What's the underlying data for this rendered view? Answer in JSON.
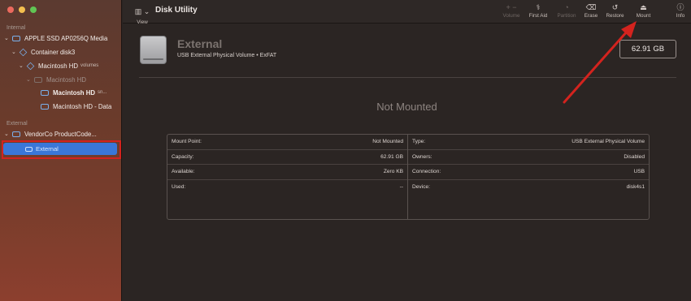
{
  "sidebar": {
    "section_internal": "Internal",
    "section_external": "External",
    "items": [
      {
        "label": "APPLE SSD AP0256Q Media",
        "suffix": ""
      },
      {
        "label": "Container disk3",
        "suffix": ""
      },
      {
        "label": "Macintosh HD",
        "suffix": "volumes"
      },
      {
        "label": "Macintosh HD",
        "suffix": ""
      },
      {
        "label": "Macintosh HD",
        "suffix": "sn..."
      },
      {
        "label": "Macintosh HD - Data",
        "suffix": ""
      },
      {
        "label": "VendorCo ProductCode...",
        "suffix": ""
      },
      {
        "label": "External",
        "suffix": ""
      }
    ]
  },
  "toolbar": {
    "view_label": "View",
    "title": "Disk Utility",
    "buttons": {
      "volume": {
        "label": "Volume",
        "glyph": "+  −"
      },
      "first_aid": {
        "label": "First Aid",
        "glyph": "⚕"
      },
      "partition": {
        "label": "Partition",
        "glyph": "◔"
      },
      "erase": {
        "label": "Erase",
        "glyph": "⌫"
      },
      "restore": {
        "label": "Restore",
        "glyph": "↺"
      },
      "mount": {
        "label": "Mount",
        "glyph": "⏏"
      },
      "info": {
        "label": "Info",
        "glyph": "ⓘ"
      }
    }
  },
  "volume": {
    "name": "External",
    "subtitle": "USB External Physical Volume • ExFAT",
    "size": "62.91 GB",
    "status": "Not Mounted"
  },
  "info": {
    "left": [
      {
        "key": "Mount Point:",
        "value": "Not Mounted"
      },
      {
        "key": "Capacity:",
        "value": "62.91 GB"
      },
      {
        "key": "Available:",
        "value": "Zero KB"
      },
      {
        "key": "Used:",
        "value": "--"
      }
    ],
    "right": [
      {
        "key": "Type:",
        "value": "USB External Physical Volume"
      },
      {
        "key": "Owners:",
        "value": "Disabled"
      },
      {
        "key": "Connection:",
        "value": "USB"
      },
      {
        "key": "Device:",
        "value": "disk4s1"
      }
    ]
  },
  "colors": {
    "selection": "#3a77d8",
    "annotation": "#d3231e",
    "disk_icon": "#7ab0ea"
  }
}
